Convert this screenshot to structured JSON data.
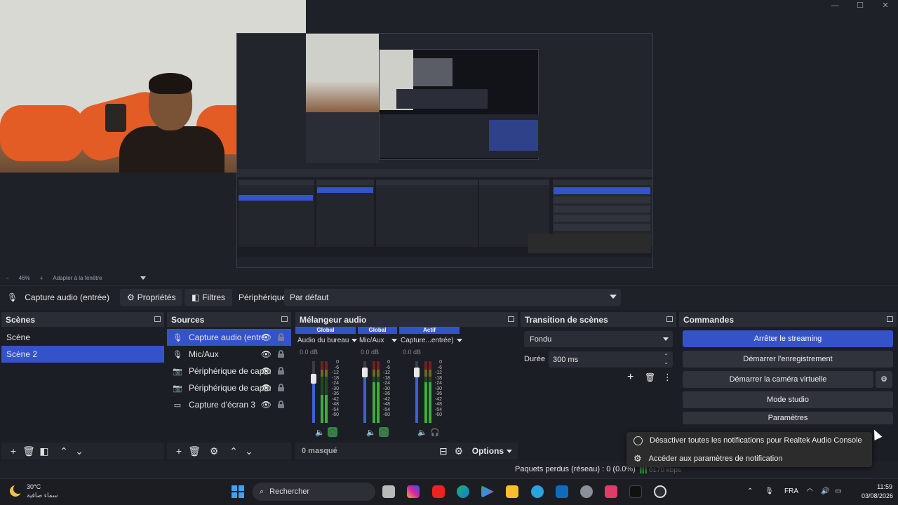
{
  "window": {
    "minimize": "—",
    "maximize": "☐",
    "close": "✕"
  },
  "preview": {
    "zoom_minus": "−",
    "zoom_level": "46%",
    "zoom_plus": "+",
    "zoom_mode": "Adapter à la fenêtre"
  },
  "source_toolbar": {
    "source_name": "Capture audio (entrée)",
    "properties_label": "Propriétés",
    "filters_label": "Filtres",
    "device_label": "Périphérique",
    "device_value": "Par défaut"
  },
  "scenes": {
    "title": "Scènes",
    "items": [
      {
        "label": "Scène"
      },
      {
        "label": "Scène 2",
        "selected": true
      }
    ]
  },
  "sources": {
    "title": "Sources",
    "items": [
      {
        "label": "Capture audio (entrée)",
        "icon": "mic-icon",
        "selected": true
      },
      {
        "label": "Mic/Aux",
        "icon": "mic-icon"
      },
      {
        "label": "Périphérique de captu",
        "icon": "camera-icon"
      },
      {
        "label": "Périphérique de captu",
        "icon": "camera-icon"
      },
      {
        "label": "Capture d'écran 3",
        "icon": "monitor-icon"
      }
    ]
  },
  "mixer": {
    "title": "Mélangeur audio",
    "channels": [
      {
        "header": "Global",
        "name": "Audio du bureau",
        "db": "0.0 dB",
        "level": 0.72
      },
      {
        "header": "Global",
        "name": "Mic/Aux",
        "db": "0.0 dB",
        "level": 0.82
      },
      {
        "header": "Actif",
        "name": "Capture...entrée)",
        "db": "0.0 dB",
        "level": 0.82
      }
    ],
    "scale": [
      "0",
      "-6",
      "-12",
      "-18",
      "-24",
      "-30",
      "-36",
      "-42",
      "-48",
      "-54",
      "-60"
    ],
    "hidden_label": "0 masqué",
    "options_label": "Options"
  },
  "transitions": {
    "title": "Transition de scènes",
    "type": "Fondu",
    "duration_label": "Durée",
    "duration_value": "300 ms"
  },
  "commands": {
    "title": "Commandes",
    "stop_stream": "Arrêter le streaming",
    "start_record": "Démarrer l'enregistrement",
    "start_vcam": "Démarrer la caméra virtuelle",
    "studio_mode": "Mode studio",
    "settings": "Paramètres"
  },
  "notification_menu": {
    "items": [
      "Désactiver toutes les notifications pour Realtek Audio Console",
      "Accéder aux paramètres de notification"
    ]
  },
  "status": {
    "dropped": "Paquets perdus (réseau) : 0 (0.0%)",
    "kbps": "6170 kbps"
  },
  "taskbar": {
    "temperature": "30°C",
    "condition": "سماء صافية",
    "search_placeholder": "Rechercher",
    "language": "FRA",
    "time": "11:59",
    "date": "03/08/2026"
  },
  "colors": {
    "accent": "#3553c9",
    "panel": "#1c1e25",
    "header": "#2a2d35",
    "meter_green": "#3bb03b"
  }
}
